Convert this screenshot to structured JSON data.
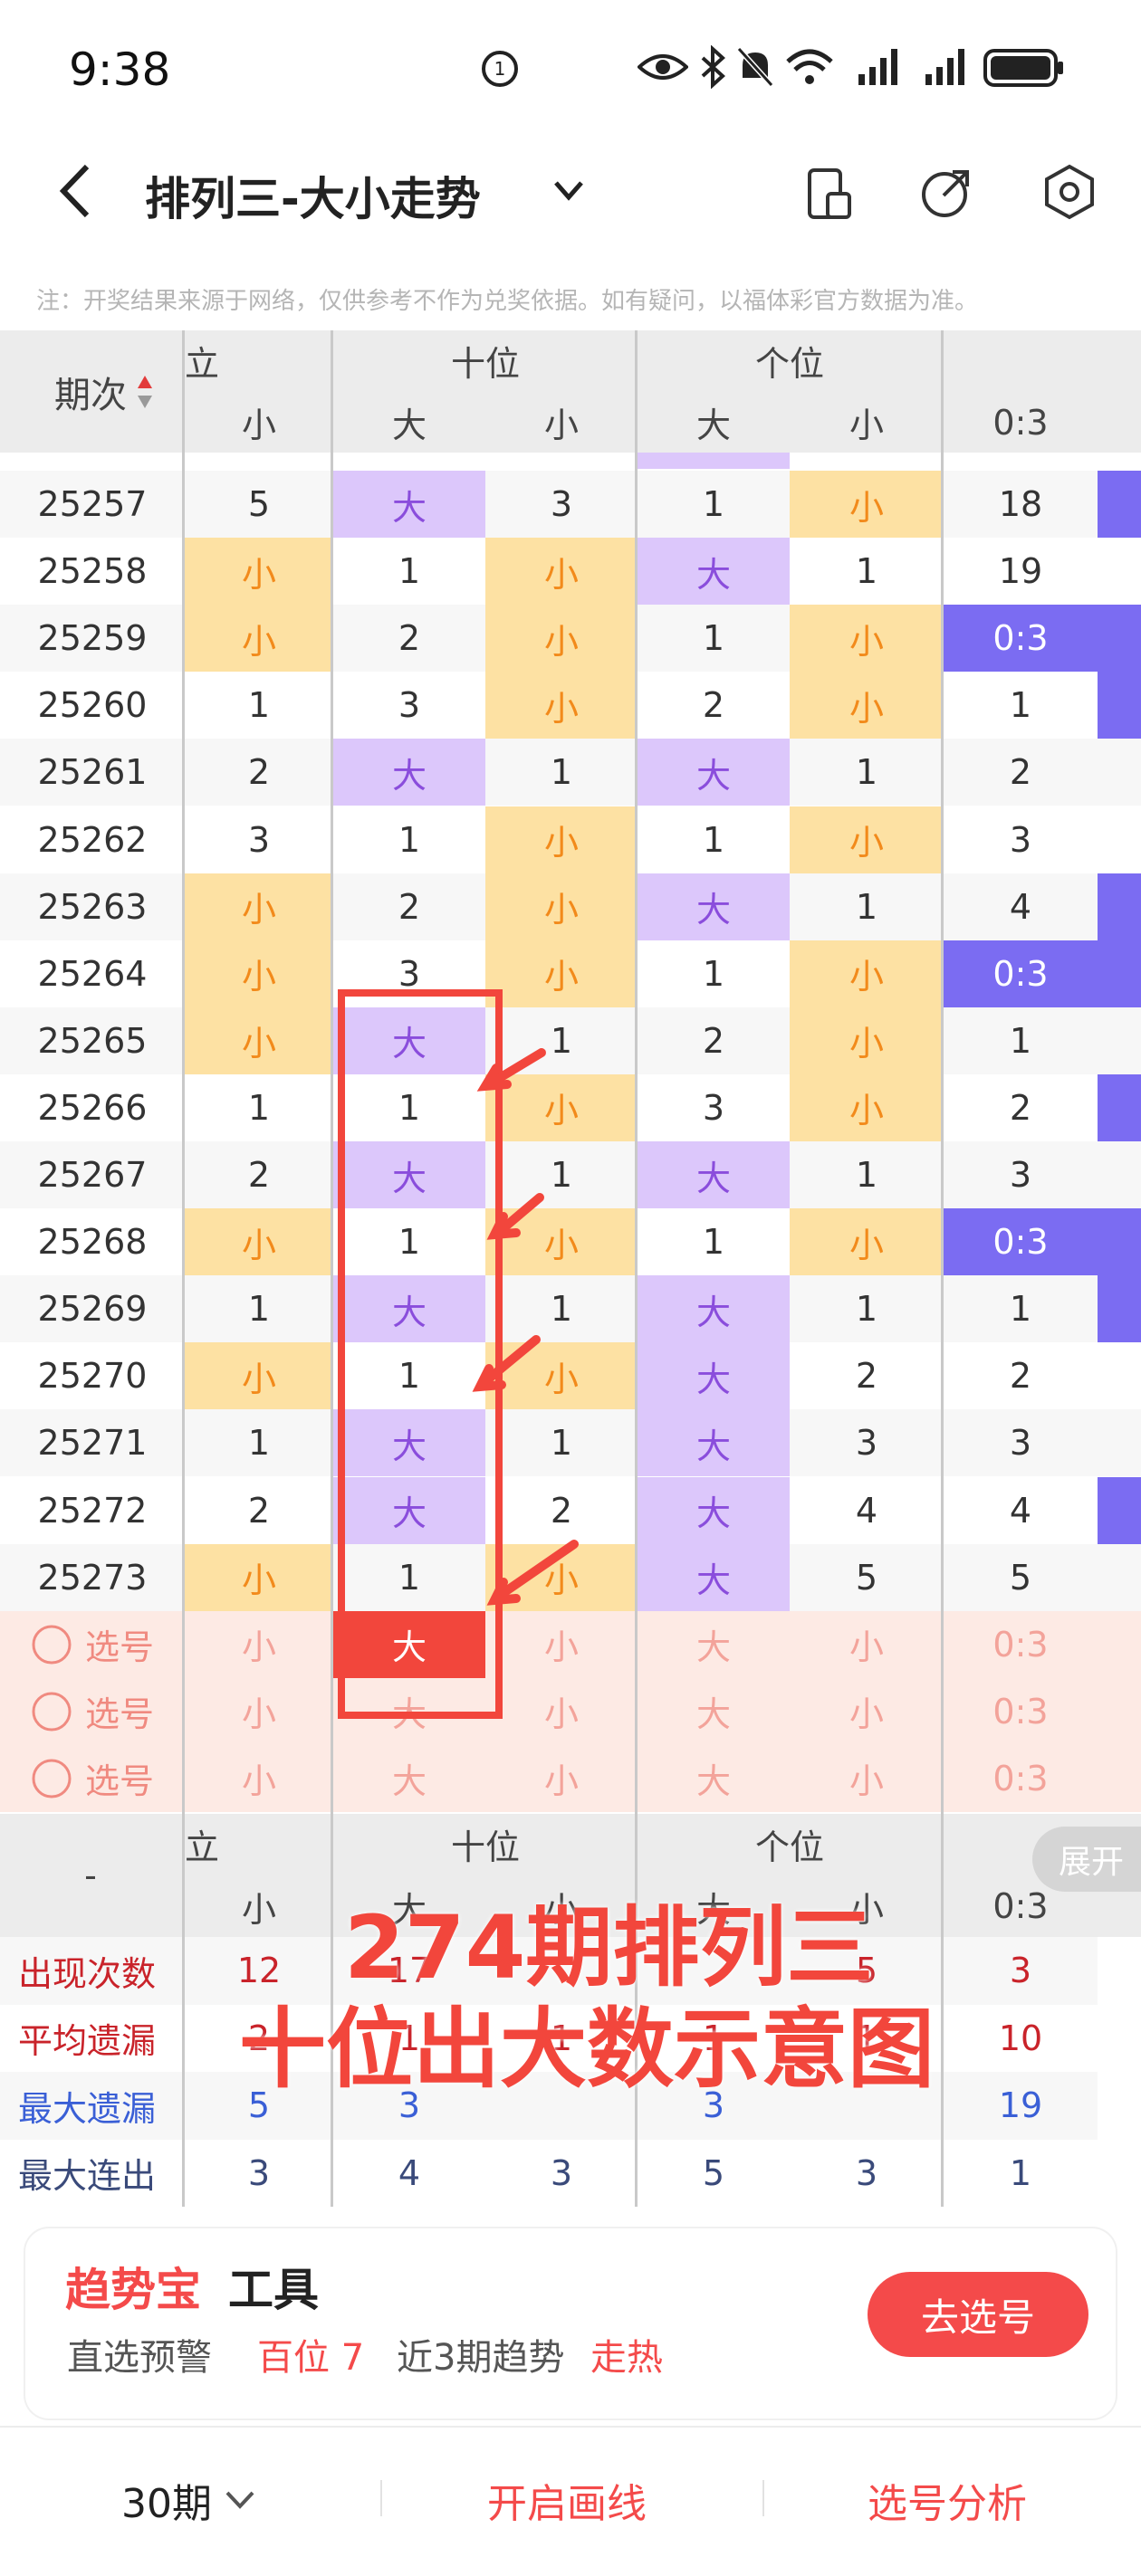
{
  "status": {
    "time": "9:38"
  },
  "header": {
    "title": "排列三-大小走势"
  },
  "note": "注：开奖结果来源于网络，仅供参考不作为兑奖依据。如有疑问，以福体彩官方数据为准。",
  "table": {
    "period_header": "期次",
    "group_headers": [
      "立",
      "十位",
      "个位"
    ],
    "sub_headers": [
      "小",
      "大",
      "小",
      "大",
      "小",
      "0:3"
    ],
    "rows": [
      {
        "p": "25257",
        "c": [
          "5",
          "大",
          "3",
          "1",
          "小",
          "18"
        ],
        "t": [
          "n",
          "big",
          "n",
          "n",
          "small",
          "n"
        ]
      },
      {
        "p": "25258",
        "c": [
          "小",
          "1",
          "小",
          "大",
          "1",
          "19"
        ],
        "t": [
          "small",
          "n",
          "small",
          "big",
          "n",
          "n"
        ]
      },
      {
        "p": "25259",
        "c": [
          "小",
          "2",
          "小",
          "1",
          "小",
          "0:3"
        ],
        "t": [
          "small",
          "n",
          "small",
          "n",
          "small",
          "c03"
        ]
      },
      {
        "p": "25260",
        "c": [
          "1",
          "3",
          "小",
          "2",
          "小",
          "1"
        ],
        "t": [
          "n",
          "n",
          "small",
          "n",
          "small",
          "n"
        ]
      },
      {
        "p": "25261",
        "c": [
          "2",
          "大",
          "1",
          "大",
          "1",
          "2"
        ],
        "t": [
          "n",
          "big",
          "n",
          "big",
          "n",
          "n"
        ]
      },
      {
        "p": "25262",
        "c": [
          "3",
          "1",
          "小",
          "1",
          "小",
          "3"
        ],
        "t": [
          "n",
          "n",
          "small",
          "n",
          "small",
          "n"
        ]
      },
      {
        "p": "25263",
        "c": [
          "小",
          "2",
          "小",
          "大",
          "1",
          "4"
        ],
        "t": [
          "small",
          "n",
          "small",
          "big",
          "n",
          "n"
        ]
      },
      {
        "p": "25264",
        "c": [
          "小",
          "3",
          "小",
          "1",
          "小",
          "0:3"
        ],
        "t": [
          "small",
          "n",
          "small",
          "n",
          "small",
          "c03"
        ]
      },
      {
        "p": "25265",
        "c": [
          "小",
          "大",
          "1",
          "2",
          "小",
          "1"
        ],
        "t": [
          "small",
          "big",
          "n",
          "n",
          "small",
          "n"
        ]
      },
      {
        "p": "25266",
        "c": [
          "1",
          "1",
          "小",
          "3",
          "小",
          "2"
        ],
        "t": [
          "n",
          "n",
          "small",
          "n",
          "small",
          "n"
        ]
      },
      {
        "p": "25267",
        "c": [
          "2",
          "大",
          "1",
          "大",
          "1",
          "3"
        ],
        "t": [
          "n",
          "big",
          "n",
          "big",
          "n",
          "n"
        ]
      },
      {
        "p": "25268",
        "c": [
          "小",
          "1",
          "小",
          "1",
          "小",
          "0:3"
        ],
        "t": [
          "small",
          "n",
          "small",
          "n",
          "small",
          "c03"
        ]
      },
      {
        "p": "25269",
        "c": [
          "1",
          "大",
          "1",
          "大",
          "1",
          "1"
        ],
        "t": [
          "n",
          "big",
          "n",
          "big",
          "n",
          "n"
        ]
      },
      {
        "p": "25270",
        "c": [
          "小",
          "1",
          "小",
          "大",
          "2",
          "2"
        ],
        "t": [
          "small",
          "n",
          "small",
          "big",
          "n",
          "n"
        ]
      },
      {
        "p": "25271",
        "c": [
          "1",
          "大",
          "1",
          "大",
          "3",
          "3"
        ],
        "t": [
          "n",
          "big",
          "n",
          "big",
          "n",
          "n"
        ]
      },
      {
        "p": "25272",
        "c": [
          "2",
          "大",
          "2",
          "大",
          "4",
          "4"
        ],
        "t": [
          "n",
          "big",
          "n",
          "big",
          "n",
          "n"
        ]
      },
      {
        "p": "25273",
        "c": [
          "小",
          "1",
          "小",
          "大",
          "5",
          "5"
        ],
        "t": [
          "small",
          "n",
          "small",
          "big",
          "n",
          "n"
        ]
      }
    ],
    "pick_label": "选号",
    "pick_rows": [
      [
        "小",
        "大",
        "小",
        "大",
        "小",
        "0:3"
      ],
      [
        "小",
        "大",
        "小",
        "大",
        "小",
        "0:3"
      ],
      [
        "小",
        "大",
        "小",
        "大",
        "小",
        "0:3"
      ]
    ],
    "footer_dash": "-",
    "expand_label": "展开",
    "stats": [
      {
        "label": "出现次数",
        "color": "#c9232a",
        "values": [
          "12",
          "17",
          "",
          "",
          "5",
          "3"
        ]
      },
      {
        "label": "平均遗漏",
        "color": "#c9232a",
        "values": [
          "2",
          "1",
          "1",
          "1",
          "1",
          "10"
        ]
      },
      {
        "label": "最大遗漏",
        "color": "#3a5fd6",
        "values": [
          "5",
          "3",
          "",
          "3",
          "",
          "19"
        ]
      },
      {
        "label": "最大连出",
        "color": "#3a4a7a",
        "values": [
          "3",
          "4",
          "3",
          "5",
          "3",
          "1"
        ]
      }
    ]
  },
  "overlay": {
    "line1": "274期排列三",
    "line2": "十位出大数示意图"
  },
  "tool": {
    "brand": "趋势宝",
    "name": "工具",
    "warn_label": "直选预警",
    "warn_value": "百位 7",
    "trend_label": "近3期趋势",
    "trend_value": "走热",
    "go_button": "去选号"
  },
  "bottom": {
    "periods": "30期",
    "draw": "开启画线",
    "analysis": "选号分析"
  },
  "colors": {
    "big": "#dcc7fb",
    "small": "#fde1a3",
    "ratio": "#7b6cf2",
    "accent": "#f44a4a"
  }
}
